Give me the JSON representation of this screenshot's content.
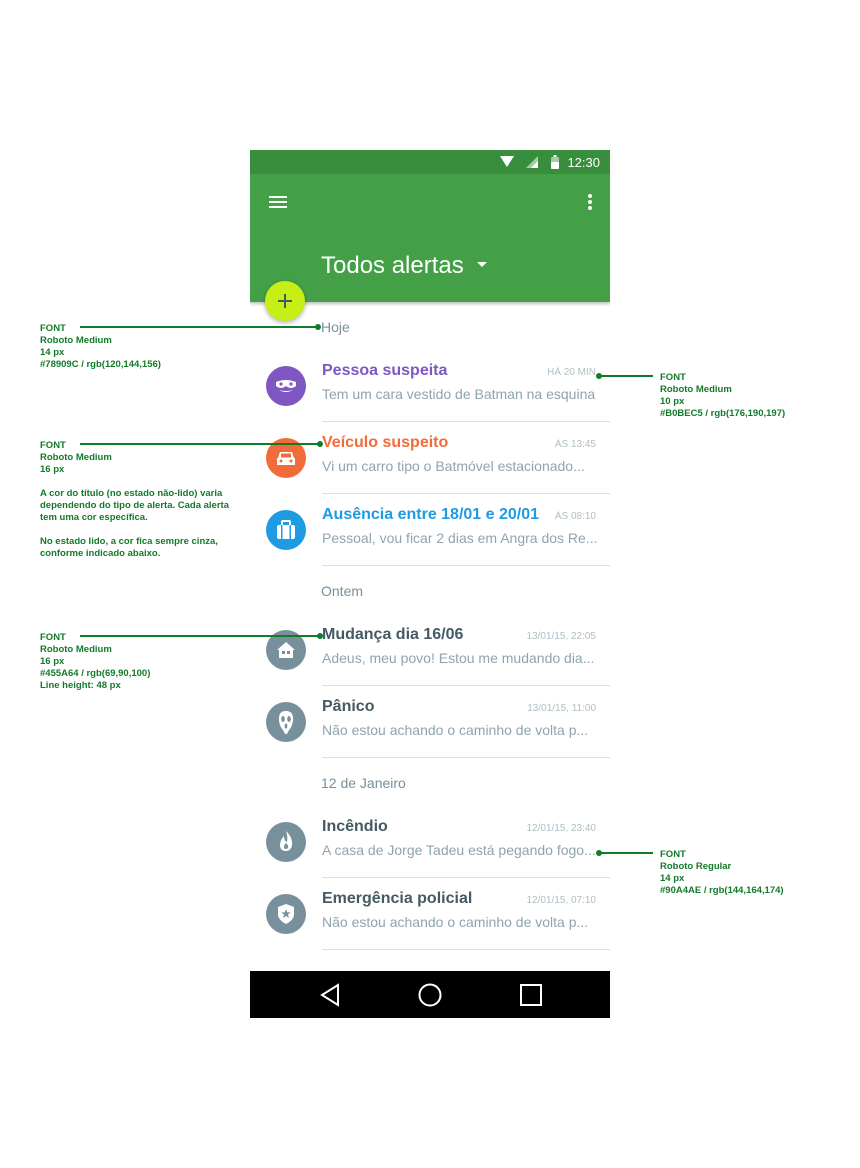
{
  "status_bar": {
    "time": "12:30"
  },
  "app_bar": {
    "title": "Todos alertas"
  },
  "sections": [
    {
      "label": "Hoje"
    },
    {
      "label": "Ontem"
    },
    {
      "label": "12 de Janeiro"
    }
  ],
  "alerts": [
    {
      "title": "Pessoa suspeita",
      "time": "HÁ 20 MIN",
      "text": "Tem um cara vestido de Batman na esquina",
      "title_color": "#7e57c2",
      "icon_bg": "#7e57c2",
      "icon": "mask-icon"
    },
    {
      "title": "Veículo suspeito",
      "time": "ÀS 13:45",
      "text": "Vi um carro tipo o Batmóvel estacionado...",
      "title_color": "#f26b3a",
      "icon_bg": "#f26b3a",
      "icon": "car-icon"
    },
    {
      "title": "Ausência entre 18/01 e 20/01",
      "time": "ÀS 08:10",
      "text": "Pessoal, vou ficar 2 dias em Angra dos Re...",
      "title_color": "#1e9be3",
      "icon_bg": "#1e9be3",
      "icon": "suitcase-icon"
    },
    {
      "title": "Mudança dia 16/06",
      "time": "13/01/15, 22:05",
      "text": "Adeus, meu povo! Estou me mudando dia...",
      "title_color": "#455a64",
      "icon_bg": "#78909c",
      "icon": "house-icon"
    },
    {
      "title": "Pânico",
      "time": "13/01/15, 11:00",
      "text": "Não estou achando o caminho de volta p...",
      "title_color": "#455a64",
      "icon_bg": "#78909c",
      "icon": "scream-mask-icon"
    },
    {
      "title": "Incêndio",
      "time": "12/01/15, 23:40",
      "text": "A casa de Jorge Tadeu está pegando fogo...",
      "title_color": "#455a64",
      "icon_bg": "#78909c",
      "icon": "fire-icon"
    },
    {
      "title": "Emergência policial",
      "time": "12/01/15, 07:10",
      "text": "Não estou achando o caminho de volta p...",
      "title_color": "#455a64",
      "icon_bg": "#78909c",
      "icon": "police-badge-icon"
    }
  ],
  "annotations": {
    "a1": "FONT\nRoboto Medium\n14 px\n#78909C / rgb(120,144,156)",
    "a2": "FONT\nRoboto Medium\n16 px\n\nA cor do título (no estado não-lido) varia\ndependendo do tipo de alerta. Cada alerta\ntem uma cor específica.\n\nNo estado lido, a cor fica sempre cinza,\nconforme indicado abaixo.",
    "a3": "FONT\nRoboto Medium\n16 px\n#455A64 / rgb(69,90,100)\nLine height: 48 px",
    "a4": "FONT\nRoboto Medium\n10 px\n#B0BEC5 / rgb(176,190,197)",
    "a5": "FONT\nRoboto Regular\n14 px\n#90A4AE / rgb(144,164,174)"
  }
}
